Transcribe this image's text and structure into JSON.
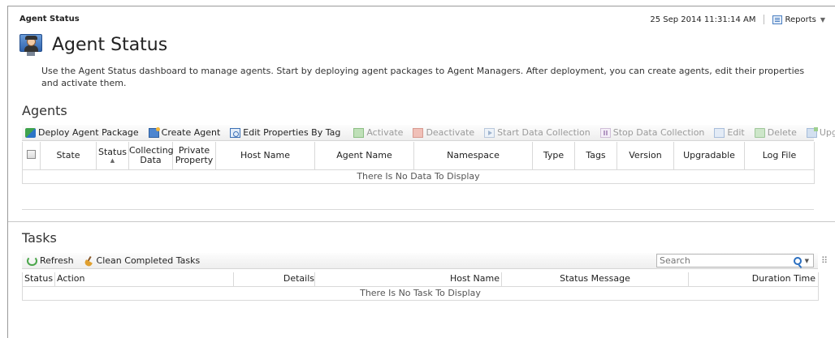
{
  "header": {
    "breadcrumb": "Agent Status",
    "timestamp": "25 Sep 2014 11:31:14 AM",
    "reports_label": "Reports",
    "reports_caret": "▼"
  },
  "page": {
    "title": "Agent Status",
    "description": "Use the Agent Status dashboard to manage agents. Start by deploying agent packages to Agent Managers. After deployment, you can create agents, edit their properties and activate them."
  },
  "agents": {
    "section_title": "Agents",
    "toolbar": {
      "deploy": "Deploy Agent Package",
      "create": "Create Agent",
      "edit_props": "Edit Properties By Tag",
      "activate": "Activate",
      "deactivate": "Deactivate",
      "start": "Start Data Collection",
      "stop": "Stop Data Collection",
      "edit": "Edit",
      "delete": "Delete",
      "upgrade": "Upgrade",
      "more": "⠿"
    },
    "columns": {
      "state": "State",
      "status": "Status",
      "sort_arrow": "▲",
      "collecting_1": "Collecting",
      "collecting_2": "Data",
      "private_1": "Private",
      "private_2": "Property",
      "host": "Host Name",
      "agent": "Agent Name",
      "namespace": "Namespace",
      "type": "Type",
      "tags": "Tags",
      "version": "Version",
      "upgradable": "Upgradable",
      "log": "Log File"
    },
    "empty_message": "There Is No Data To Display"
  },
  "tasks": {
    "section_title": "Tasks",
    "toolbar": {
      "refresh": "Refresh",
      "clean": "Clean Completed Tasks",
      "more": "⠿"
    },
    "search": {
      "placeholder": "Search",
      "caret": "▼"
    },
    "columns": {
      "status": "Status",
      "action": "Action",
      "details": "Details",
      "host": "Host Name",
      "status_message": "Status Message",
      "duration": "Duration Time"
    },
    "empty_message": "There Is No Task To Display"
  },
  "colors": {
    "accent": "#2b6fc0",
    "disabled_text": "#9a9a9a"
  }
}
